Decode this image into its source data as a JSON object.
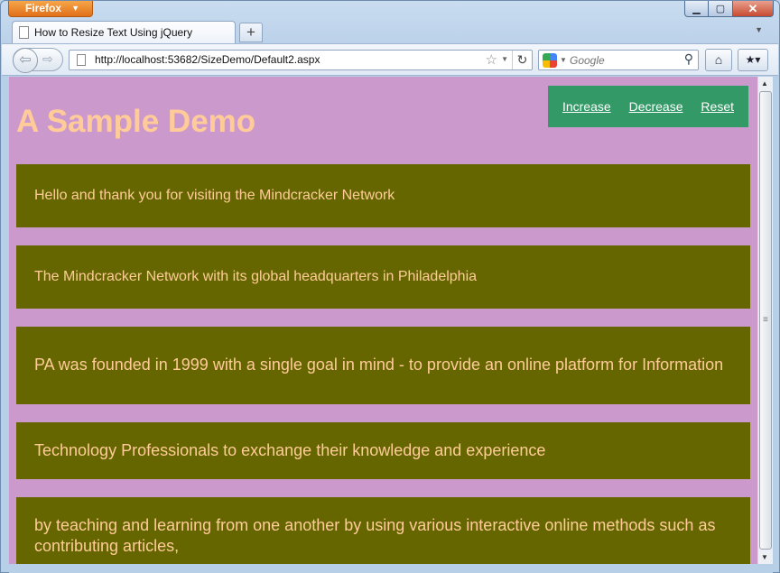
{
  "browser": {
    "menu_label": "Firefox",
    "tab_title": "How to Resize Text Using jQuery",
    "new_tab_symbol": "+",
    "url": "http://localhost:53682/SizeDemo/Default2.aspx",
    "search_engine": "Google",
    "search_placeholder": "Google"
  },
  "page": {
    "background_color": "#cc99cc",
    "heading": "A Sample Demo",
    "heading_color": "#ffcc99",
    "controls_bg": "#339966",
    "controls": {
      "increase": "Increase",
      "decrease": "Decrease",
      "reset": "Reset"
    },
    "box_bg": "#666600",
    "box_text_color": "#ffcc99",
    "paragraphs": [
      "Hello and thank you for visiting the Mindcracker Network",
      "The Mindcracker Network with its global headquarters in Philadelphia",
      "PA was founded in 1999 with a single goal in mind - to provide an online platform for Information",
      "Technology Professionals to exchange their knowledge and experience",
      "by teaching and learning from one another by using various interactive online methods such as contributing articles,"
    ]
  }
}
